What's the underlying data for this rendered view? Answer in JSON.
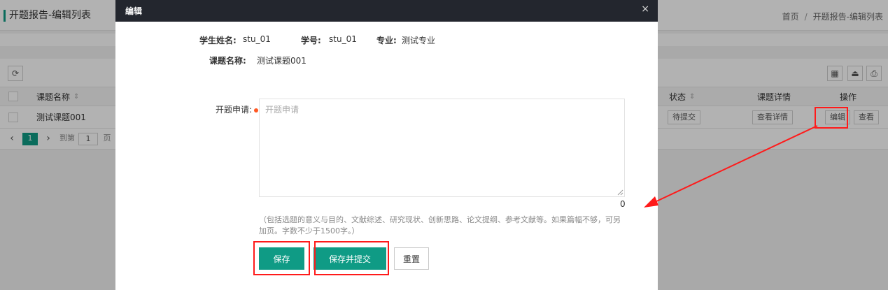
{
  "page": {
    "title": "开题报告-编辑列表",
    "breadcrumb": [
      "首页",
      "开题报告-编辑列表"
    ],
    "breadcrumb_sep": "/"
  },
  "toolbar": {
    "refresh_icon": "refresh-icon",
    "right_icons": [
      "grid-icon",
      "export-icon",
      "print-icon"
    ],
    "refresh_glyph": "⟳",
    "grid_glyph": "▦",
    "export_glyph": "⏏",
    "print_glyph": "⎙"
  },
  "table": {
    "columns": {
      "name": "课题名称",
      "status": "状态",
      "detail": "课题详情",
      "action": "操作"
    },
    "sort_glyph": "⇕",
    "rows": [
      {
        "name": "测试课题001",
        "status": "待提交",
        "detail_button": "查看详情",
        "edit_button": "编辑",
        "view_button": "查看"
      }
    ]
  },
  "pager": {
    "prev": "‹",
    "current": "1",
    "next": "›",
    "goto_label": "到第",
    "goto_value": "1",
    "page_suffix": "页"
  },
  "modal": {
    "title": "编辑",
    "close_glyph": "×",
    "student_name_label": "学生姓名:",
    "student_name_value": "stu_01",
    "student_no_label": "学号:",
    "student_no_value": "stu_01",
    "major_label": "专业:",
    "major_value": "测试专业",
    "topic_label": "课题名称:",
    "topic_value": "测试课题001",
    "application_label": "开题申请:",
    "application_placeholder": "开题申请",
    "application_value": "",
    "char_count": "0",
    "hint": "（包括选题的意义与目的、文献综述、研究现状、创新思路、论文提纲、参考文献等。如果篇幅不够，可另加页。字数不少于1500字。）",
    "save_button": "保存",
    "save_submit_button": "保存并提交",
    "reset_button": "重置"
  },
  "colors": {
    "primary": "#0f9b85",
    "header_dark": "#23262e",
    "annotation_red": "#ff1a1a",
    "required": "#ff5722"
  }
}
